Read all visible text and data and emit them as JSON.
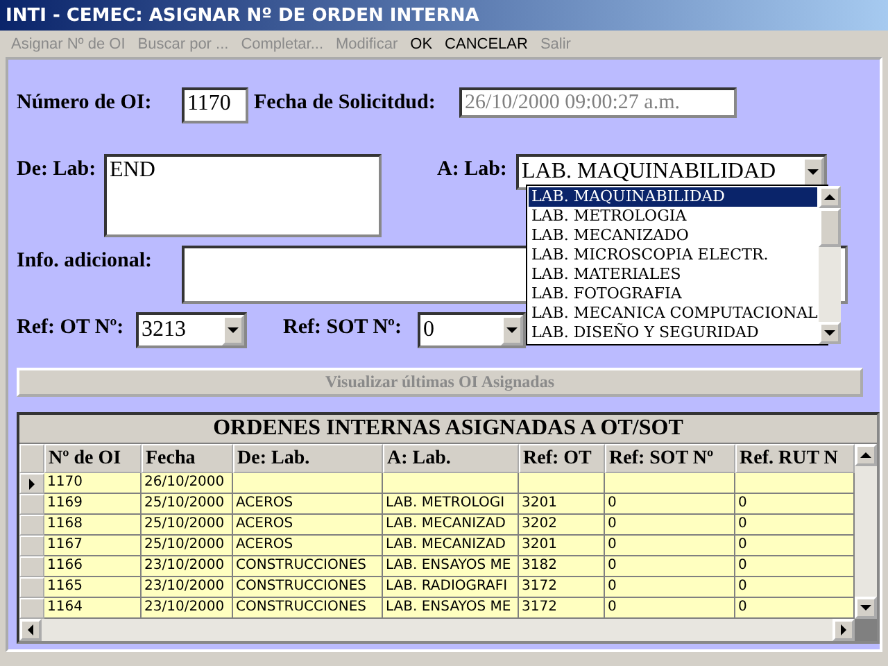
{
  "window": {
    "title": "INTI - CEMEC: ASIGNAR Nº DE ORDEN INTERNA"
  },
  "menu": [
    {
      "label": "Asignar Nº de OI",
      "disabled": true
    },
    {
      "label": "Buscar por ...",
      "disabled": true
    },
    {
      "label": "Completar...",
      "disabled": true
    },
    {
      "label": "Modificar",
      "disabled": true
    },
    {
      "label": "OK",
      "disabled": false
    },
    {
      "label": "CANCELAR",
      "disabled": false
    },
    {
      "label": "Salir",
      "disabled": true
    }
  ],
  "form": {
    "numero_oi": {
      "label": "Número de OI:",
      "value": "1170"
    },
    "fecha": {
      "label": "Fecha de Solicitdud:",
      "value": "26/10/2000 09:00:27 a.m.",
      "disabled": true
    },
    "de_lab": {
      "label": "De: Lab:",
      "value": "END"
    },
    "a_lab": {
      "label": "A: Lab:",
      "value": "LAB. MAQUINABILIDAD",
      "expanded": true,
      "options": [
        {
          "label": "LAB. MAQUINABILIDAD",
          "selected": true
        },
        {
          "label": "LAB. METROLOGIA",
          "selected": false
        },
        {
          "label": "LAB. MECANIZADO",
          "selected": false
        },
        {
          "label": "LAB. MICROSCOPIA ELECTR.",
          "selected": false
        },
        {
          "label": "LAB. MATERIALES",
          "selected": false
        },
        {
          "label": "LAB. FOTOGRAFIA",
          "selected": false
        },
        {
          "label": "LAB. MECANICA COMPUTACIONAL",
          "selected": false
        },
        {
          "label": "LAB. DISEÑO Y SEGURIDAD",
          "selected": false
        }
      ]
    },
    "info": {
      "label": "Info. adicional:"
    },
    "ref_ot": {
      "label": "Ref: OT Nº:",
      "value": "3213"
    },
    "ref_sot": {
      "label": "Ref: SOT Nº:",
      "value": "0"
    },
    "button": {
      "label": "Visualizar últimas OI Asignadas",
      "disabled": true
    }
  },
  "table": {
    "title": "ORDENES INTERNAS ASIGNADAS A OT/SOT",
    "columns": [
      "Nº de OI",
      "Fecha",
      "De: Lab.",
      "A: Lab.",
      "Ref: OT",
      "Ref: SOT Nº",
      "Ref. RUT N"
    ],
    "rows": [
      {
        "selected": true,
        "cells": [
          "1170",
          "26/10/2000",
          "",
          "",
          "",
          "",
          ""
        ]
      },
      {
        "selected": false,
        "cells": [
          "1169",
          "25/10/2000",
          "ACEROS",
          "LAB. METROLOGI",
          "3201",
          "0",
          "0"
        ]
      },
      {
        "selected": false,
        "cells": [
          "1168",
          "25/10/2000",
          "ACEROS",
          "LAB. MECANIZAD",
          "3202",
          "0",
          "0"
        ]
      },
      {
        "selected": false,
        "cells": [
          "1167",
          "25/10/2000",
          "ACEROS",
          "LAB. MECANIZAD",
          "3201",
          "0",
          "0"
        ]
      },
      {
        "selected": false,
        "cells": [
          "1166",
          "23/10/2000",
          "CONSTRUCCIONES",
          "LAB. ENSAYOS ME",
          "3182",
          "0",
          "0"
        ]
      },
      {
        "selected": false,
        "cells": [
          "1165",
          "23/10/2000",
          "CONSTRUCCIONES",
          "LAB. RADIOGRAFI",
          "3172",
          "0",
          "0"
        ]
      },
      {
        "selected": false,
        "cells": [
          "1164",
          "23/10/2000",
          "CONSTRUCCIONES",
          "LAB. ENSAYOS ME",
          "3172",
          "0",
          "0"
        ]
      }
    ]
  }
}
